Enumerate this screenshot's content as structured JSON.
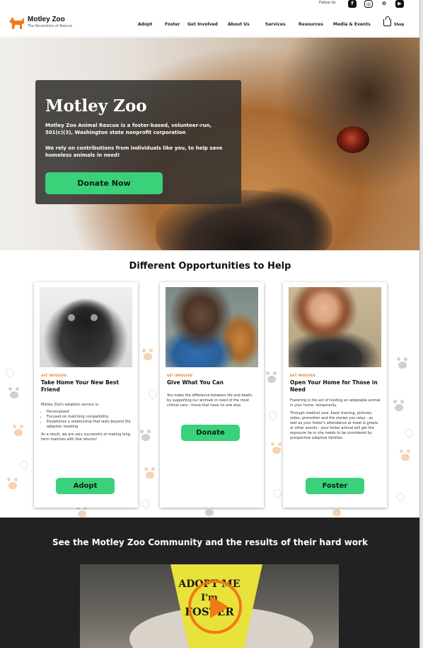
{
  "topbar": {
    "follow_label": "Follow Us",
    "social_icons": [
      "facebook-icon",
      "instagram-icon",
      "twitter-icon",
      "youtube-icon"
    ]
  },
  "header": {
    "brand": "Motley Zoo",
    "tagline": "The Revolution of Rescue",
    "nav": [
      "Adopt",
      "Foster",
      "Get Involved",
      "About Us",
      "Services",
      "Resources",
      "Media & Events"
    ],
    "shop_label": "Shop"
  },
  "hero": {
    "title": "Motley Zoo",
    "paragraph1": "Motley Zoo Animal Rescue is a foster-based, volunteer-run, 501(c)(3), Washington state nonprofit corporation",
    "paragraph2": "We rely on contributions from individuals like you, to help save homeless animals in need!",
    "cta": "Donate Now"
  },
  "opportunities": {
    "title": "Different Opportunities to Help",
    "cards": [
      {
        "kicker": "GET INVOLVED",
        "title": "Take Home Your New Best Friend",
        "intro": "Motley Zoo's adoption service is:",
        "bullets": [
          "Personalized",
          "Focused on matching compatibility",
          "Establishes a relationship that lasts beyond the adoption meeting"
        ],
        "outro": "As a result, we are very successful at making long-term matches with few returns!",
        "button": "Adopt"
      },
      {
        "kicker": "GET INVOLVED",
        "title": "Give What You Can",
        "body": "You make the difference between life and death, by supporting our animals in need of the most critical care - those that have no one else.",
        "button": "Donate"
      },
      {
        "kicker": "GET INVOLVED",
        "title": "Open Your Home for Those in Need",
        "body": "Fostering is the act of hosting an adoptable animal in your home, temporarily.",
        "body2": "Through medical care, basic training, pictures, video, promotion and the stories you relay - as well as your foster's attendance at meet & greets or other events - your foster animal will get the exposure he or she needs to be considered by prospective adoptive families.",
        "button": "Foster"
      }
    ]
  },
  "community": {
    "title": "See the Motley Zoo Community and the results of their hard work",
    "video_text": [
      "ADOPT ME",
      "I'm",
      "FOSTER"
    ]
  },
  "colors": {
    "accent_green": "#3ad17a",
    "brand_orange": "#f07a16",
    "dark_band": "#222222"
  }
}
